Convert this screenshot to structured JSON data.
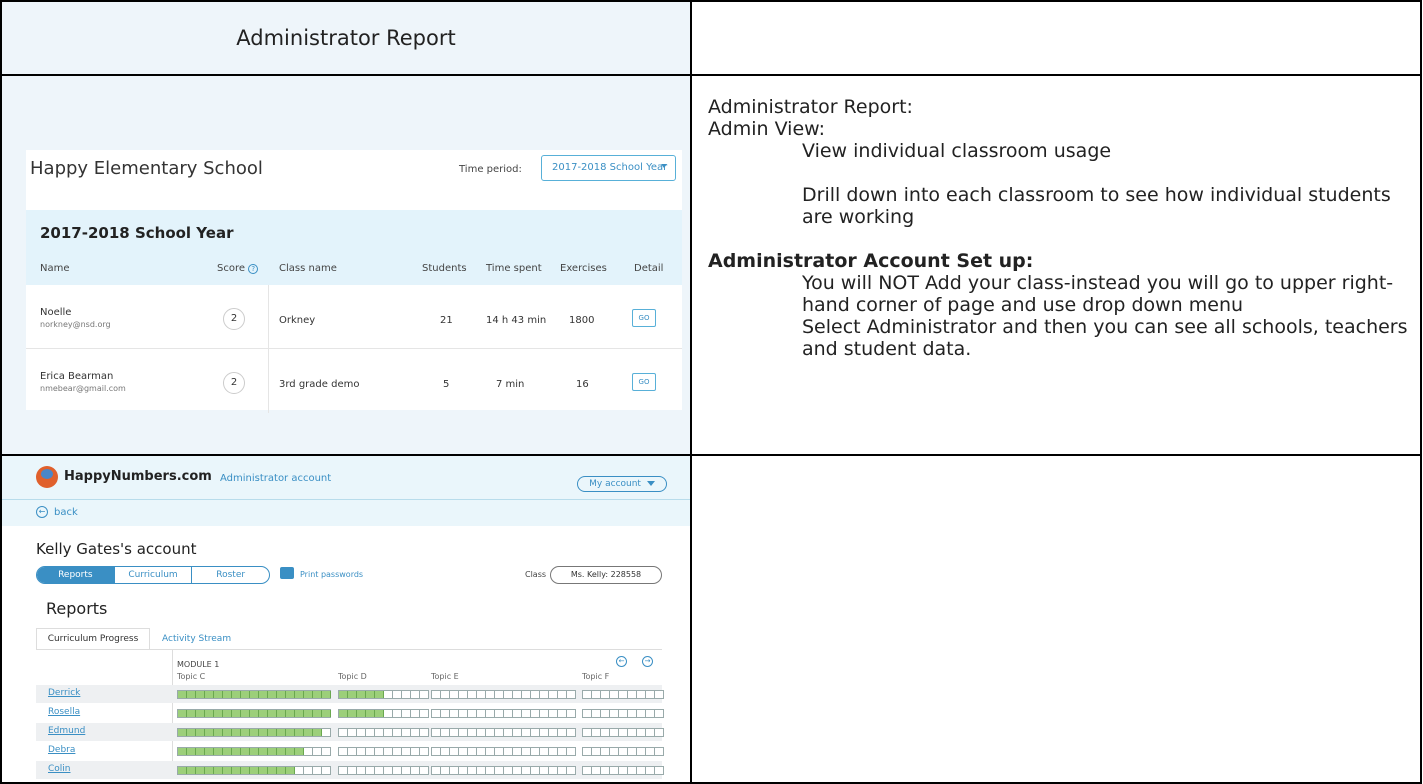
{
  "header": {
    "title": "Administrator Report"
  },
  "notes": {
    "heading1": "Administrator Report:",
    "heading2": "Admin View:",
    "item1": "View individual classroom usage",
    "item2": "Drill down into each classroom to see how individual students are working",
    "heading3": "Administrator Account Set up:",
    "item3": "You will NOT Add your class-instead you will go to upper right-hand corner of page and use drop down menu",
    "item4": "Select Administrator and then you can see all schools, teachers and student data."
  },
  "school_report": {
    "school_name": "Happy Elementary School",
    "time_period_label": "Time period:",
    "time_period_value": "2017-2018 School Year",
    "year_heading": "2017-2018 School Year",
    "columns": {
      "name": "Name",
      "score": "Score",
      "score_help": "?",
      "class_name": "Class name",
      "students": "Students",
      "time_spent": "Time spent",
      "exercises": "Exercises",
      "detail": "Detail"
    },
    "rows": [
      {
        "name": "Noelle",
        "email": "norkney@nsd.org",
        "score": "2",
        "class_name": "Orkney",
        "students": "21",
        "time_spent": "14 h 43 min",
        "exercises": "1800",
        "detail": "GO"
      },
      {
        "name": "Erica Bearman",
        "email": "nmebear@gmail.com",
        "score": "2",
        "class_name": "3rd grade demo",
        "students": "5",
        "time_spent": "7 min",
        "exercises": "16",
        "detail": "GO"
      }
    ]
  },
  "account_view": {
    "brand": "HappyNumbers.com",
    "account_type": "Administrator account",
    "my_account": "My account",
    "back": "back",
    "account_title": "Kelly Gates's account",
    "tabs": [
      "Reports",
      "Curriculum",
      "Roster"
    ],
    "print_passwords": "Print passwords",
    "class_label": "Class",
    "class_value": "Ms. Kelly: 228558",
    "reports_heading": "Reports",
    "report_tabs": [
      "Curriculum Progress",
      "Activity Stream"
    ],
    "module": "MODULE 1",
    "topics": [
      "Topic C",
      "Topic D",
      "Topic E",
      "Topic F"
    ],
    "segments_per_topic": [
      17,
      10,
      16,
      9
    ],
    "students": [
      {
        "name": "Derrick",
        "progress": [
          17,
          5,
          0,
          0
        ]
      },
      {
        "name": "Rosella",
        "progress": [
          17,
          5,
          0,
          0
        ]
      },
      {
        "name": "Edmund",
        "progress": [
          16,
          0,
          0,
          0
        ]
      },
      {
        "name": "Debra",
        "progress": [
          14,
          0,
          0,
          0
        ]
      },
      {
        "name": "Colin",
        "progress": [
          13,
          0,
          0,
          0
        ]
      }
    ],
    "colors": {
      "accent": "#3a8fc4",
      "progress_fill": "#9ccf7a"
    }
  }
}
